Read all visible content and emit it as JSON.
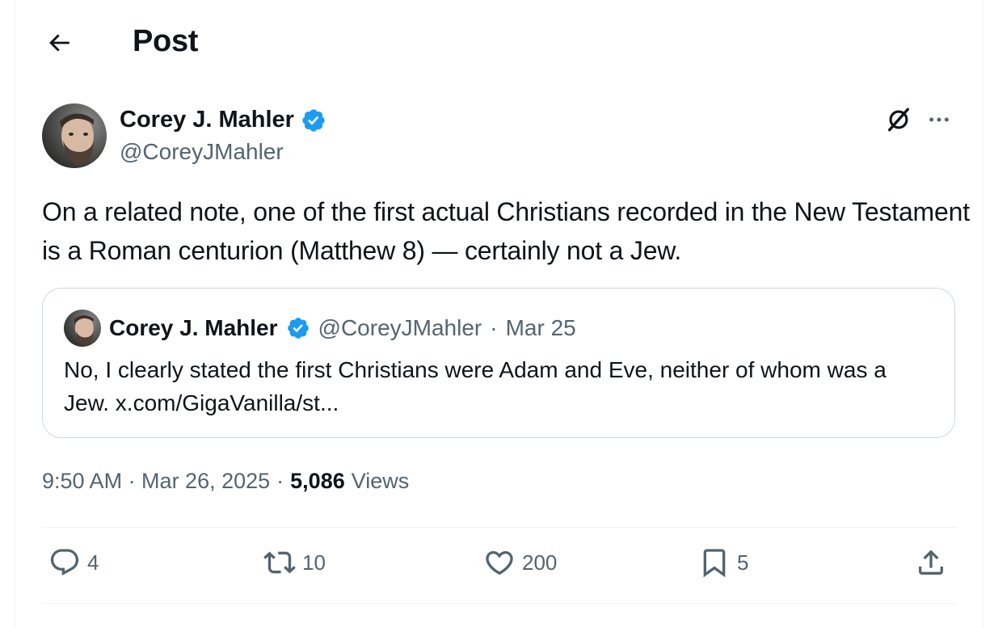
{
  "header": {
    "title": "Post",
    "back_icon": "arrow-left-icon"
  },
  "post": {
    "author": {
      "display_name": "Corey J. Mahler",
      "handle": "@CoreyJMahler",
      "verified": true
    },
    "text": "On a related note, one of the first actual Christians recorded in the New Testament is a Roman centurion (Matthew 8) — certainly not a Jew.",
    "timestamp": "9:50 AM · Mar 26, 2025",
    "views_count": "5,086",
    "views_label": "Views"
  },
  "quote": {
    "display_name": "Corey J. Mahler",
    "handle": "@CoreyJMahler",
    "separator": "·",
    "date": "Mar 25",
    "text": "No, I clearly stated the first Christians were Adam and Eve, neither of whom was a Jew. x.com/GigaVanilla/st..."
  },
  "actions": {
    "replies": "4",
    "reposts": "10",
    "likes": "200",
    "bookmarks": "5"
  },
  "colors": {
    "text_primary": "#0f1419",
    "text_secondary": "#536471",
    "verified_blue": "#1d9bf0",
    "border": "#cfd9de"
  }
}
